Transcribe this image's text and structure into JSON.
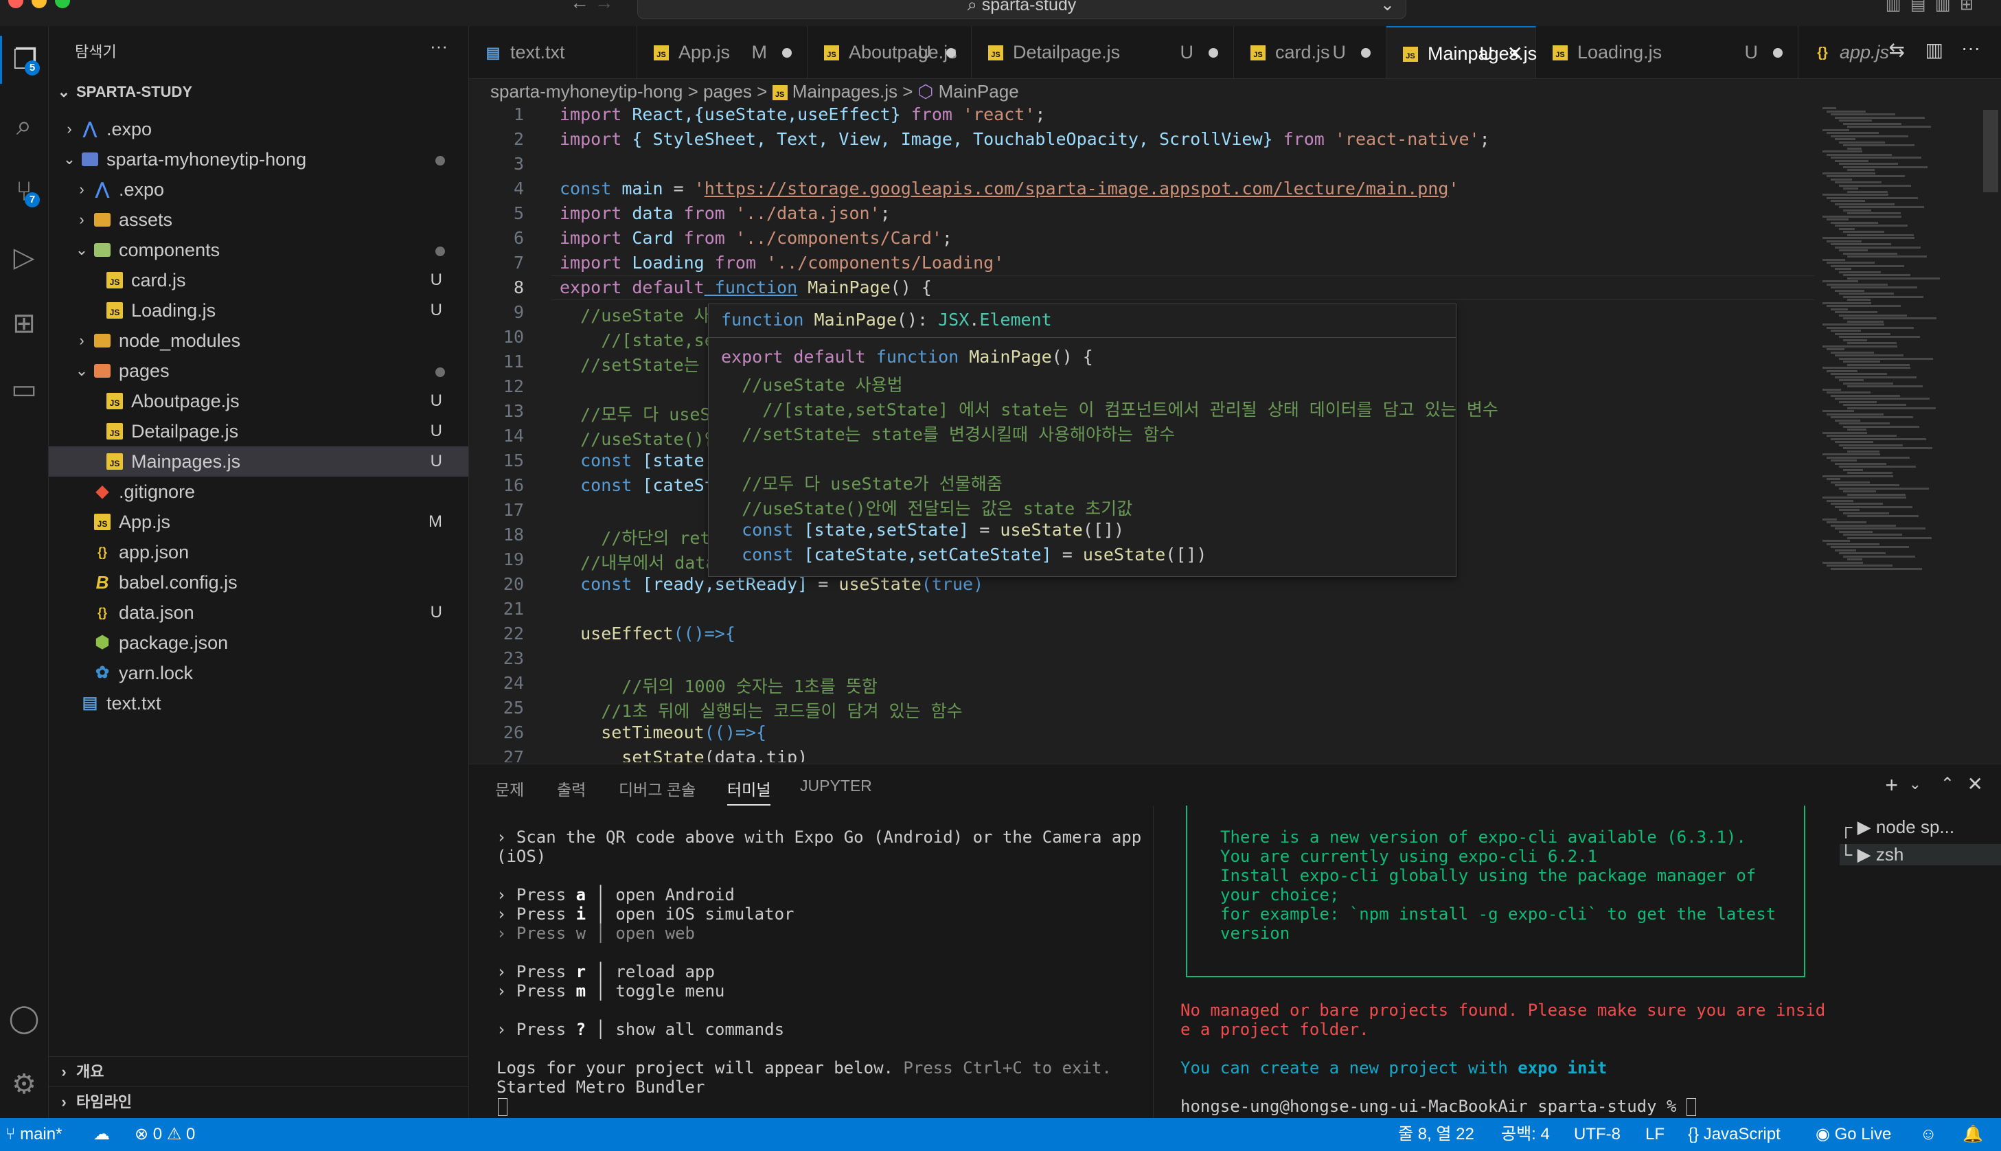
{
  "titlebar": {
    "search_text": "sparta-study",
    "search_icon": "search-icon"
  },
  "activity": {
    "explorer_badge": "5",
    "scm_badge": "7"
  },
  "sidebar": {
    "title": "탐색기",
    "more": "···",
    "root": "SPARTA-STUDY",
    "items": [
      {
        "label": ".expo",
        "mark": ""
      },
      {
        "label": "sparta-myhoneytip-hong",
        "mark": ""
      },
      {
        "label": ".expo",
        "mark": ""
      },
      {
        "label": "assets",
        "mark": ""
      },
      {
        "label": "components",
        "mark": ""
      },
      {
        "label": "card.js",
        "mark": "U"
      },
      {
        "label": "Loading.js",
        "mark": "U"
      },
      {
        "label": "node_modules",
        "mark": ""
      },
      {
        "label": "pages",
        "mark": ""
      },
      {
        "label": "Aboutpage.js",
        "mark": "U"
      },
      {
        "label": "Detailpage.js",
        "mark": "U"
      },
      {
        "label": "Mainpages.js",
        "mark": "U"
      },
      {
        "label": ".gitignore",
        "mark": ""
      },
      {
        "label": "App.js",
        "mark": "M"
      },
      {
        "label": "app.json",
        "mark": ""
      },
      {
        "label": "babel.config.js",
        "mark": ""
      },
      {
        "label": "data.json",
        "mark": "U"
      },
      {
        "label": "package.json",
        "mark": ""
      },
      {
        "label": "yarn.lock",
        "mark": ""
      },
      {
        "label": "text.txt",
        "mark": ""
      }
    ],
    "outline": "개요",
    "timeline": "타임라인"
  },
  "tabs": [
    {
      "label": "text.txt",
      "mark": ""
    },
    {
      "label": "App.js",
      "mark": "M"
    },
    {
      "label": "Aboutpage.js",
      "mark": "U"
    },
    {
      "label": "Detailpage.js",
      "mark": "U"
    },
    {
      "label": "card.js",
      "mark": "U"
    },
    {
      "label": "Mainpages.js",
      "mark": "U"
    },
    {
      "label": "Loading.js",
      "mark": "U"
    },
    {
      "label": "app.js",
      "mark": ""
    }
  ],
  "breadcrumb": {
    "p1": "sparta-myhoneytip-hong",
    "sep": ">",
    "p2": "pages",
    "p3": "Mainpages.js",
    "p4": "MainPage"
  },
  "code": {
    "l1a": "import",
    "l1b": " React,",
    "l1c": "{useState,useEffect}",
    "l1d": " from ",
    "l1e": "'react'",
    "l1f": ";",
    "l2a": "import",
    "l2b": " { StyleSheet, Text, View, Image, TouchableOpacity, ScrollView}",
    "l2d": " from ",
    "l2e": "'react-native'",
    "l2f": ";",
    "l4a": "const",
    "l4b": " main",
    "l4c": " = ",
    "l4d": "'",
    "l4e": "https://storage.googleapis.com/sparta-image.appspot.com/lecture/main.png",
    "l4f": "'",
    "l5a": "import",
    "l5b": " data",
    "l5d": " from ",
    "l5e": "'../data.json'",
    "l5f": ";",
    "l6a": "import",
    "l6b": " Card",
    "l6d": " from ",
    "l6e": "'../components/Card'",
    "l6f": ";",
    "l7a": "import",
    "l7b": " Loading",
    "l7d": " from ",
    "l7e": "'../components/Loading'",
    "l8a": "export default",
    "l8b": " function",
    "l8c": " MainPage",
    "l8d": "() {",
    "l9": "  //useState 사용법",
    "l10": "    //[state,setState] 에서 state는 이 컴포넌트에서 관리될 상태 데이터를 담고 있는 변수",
    "l11": "  //setState는 state를 변경시킬때 사용해야하는 함수",
    "l13": "  //모두 다 useState가 선물해줌",
    "l14": "  //useState()안에 전달되는 값은 state 초기값",
    "l15a": "  const",
    "l15b": " [state,setState]",
    "l15c": " = ",
    "l15d": "useState",
    "l15e": "([])",
    "l16a": "  const",
    "l16b": " [cateState,setCateState]",
    "l16c": " = ",
    "l16d": "useState",
    "l16e": "([])",
    "l18": "    //하단의 return 문이 실행되어 화면이 그려진다음 실행되는 useEffect 함수",
    "l19": "  //내부에서 data.json으로 부터 가져온 데이터를 state 상태에 담고 있음",
    "l20a": "  const",
    "l20b": " [ready,setReady]",
    "l20c": " = ",
    "l20d": "useState",
    "l20e": "(true)",
    "l22a": "  useEffect",
    "l22b": "(()=>{",
    "l24": "      //뒤의 1000 숫자는 1초를 뜻함",
    "l25": "    //1초 뒤에 실행되는 코드들이 담겨 있는 함수",
    "l26a": "    setTimeout",
    "l26b": "(()=>{",
    "l27a": "      setState",
    "l27b": "(data.tip)"
  },
  "hover": {
    "sig_a": "function",
    "sig_b": " MainPage",
    "sig_c": "(): ",
    "sig_d": "JSX",
    "sig_e": ".",
    "sig_f": "Element",
    "h1a": "export default",
    "h1b": " function",
    "h1c": " MainPage",
    "h1d": "() {",
    "h2": "  //useState 사용법",
    "h3": "    //[state,setState] 에서 state는 이 컴포넌트에서 관리될 상태 데이터를 담고 있는 변수",
    "h4": "  //setState는 state를 변경시킬때 사용해야하는 함수",
    "h6": "  //모두 다 useState가 선물해줌",
    "h7": "  //useState()안에 전달되는 값은 state 초기값",
    "h8a": "  const",
    "h8b": " [state,setState]",
    "h8c": " = ",
    "h8d": "useState",
    "h8e": "([])",
    "h9a": "  const",
    "h9b": " [cateState,setCateState]",
    "h9c": " = ",
    "h9d": "useState",
    "h9e": "([])"
  },
  "panel": {
    "tabs": [
      "문제",
      "출력",
      "디버그 콘솔",
      "터미널",
      "JUPYTER"
    ],
    "t1": "› Scan the QR code above with Expo Go (Android) or the Camera app",
    "t2": "(iOS)",
    "t3a": "› Press ",
    "t3b": "a",
    "t3c": " │ open Android",
    "t4a": "› Press ",
    "t4b": "i",
    "t4c": " │ open iOS simulator",
    "t5": "› Press w │ open web",
    "t6a": "› Press ",
    "t6b": "r",
    "t6c": " │ reload app",
    "t7a": "› Press ",
    "t7b": "m",
    "t7c": " │ toggle menu",
    "t8a": "› Press ",
    "t8b": "?",
    "t8c": " │ show all commands",
    "t9a": "Logs for your project will appear below.",
    "t9b": " Press Ctrl+C to exit.",
    "t10": "Started Metro Bundler",
    "r1": "There is a new version of expo-cli available (6.3.1).",
    "r2": "You are currently using expo-cli 6.2.1",
    "r3": "Install expo-cli globally using the package manager of",
    "r4": "your choice;",
    "r5": "for example: `npm install -g expo-cli` to get the latest",
    "r6": "version",
    "r7": "No managed or bare projects found. Please make sure you are insid",
    "r8": "e a project folder.",
    "r9a": "You can create a new project with ",
    "r9b": "expo init",
    "r10": "hongse-ung@hongse-ung-ui-MacBookAir sparta-study % ",
    "term1": "node sp...",
    "term2": "zsh"
  },
  "status": {
    "branch": "main*",
    "errors": "0",
    "warnings": "0",
    "position": "줄 8, 열 22",
    "indent": "공백: 4",
    "encoding": "UTF-8",
    "eol": "LF",
    "lang": "JavaScript",
    "golive": "Go Live"
  }
}
